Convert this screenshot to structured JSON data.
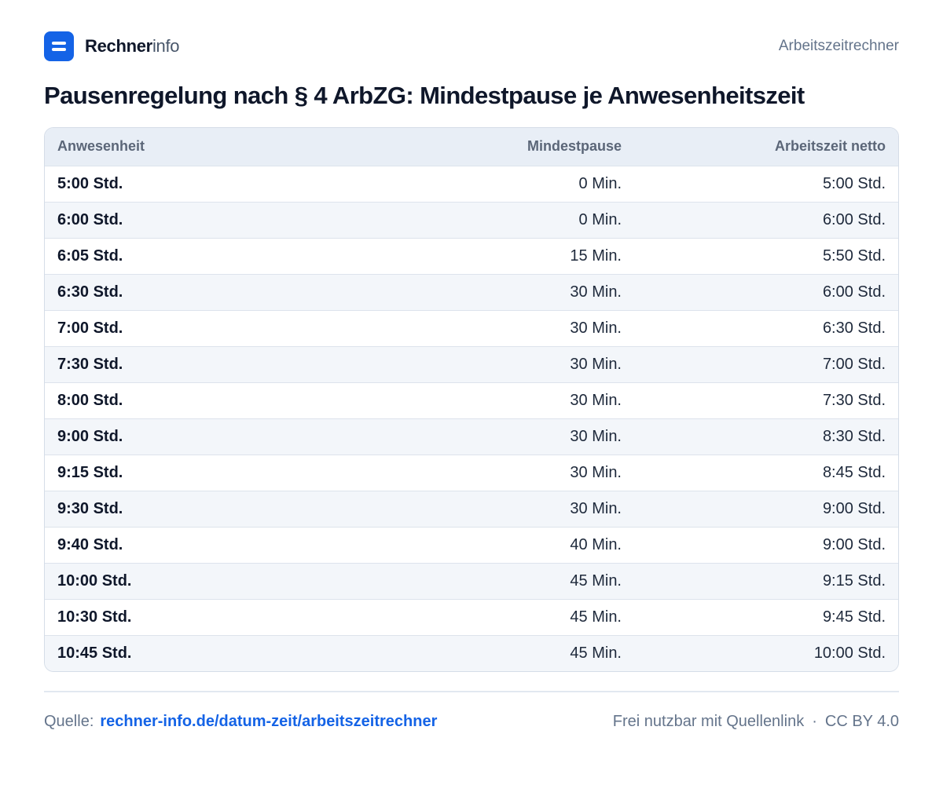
{
  "header": {
    "brand_strong": "Rechner",
    "brand_light": "info",
    "page_label": "Arbeitszeitrechner"
  },
  "title": "Pausenregelung nach § 4 ArbZG: Mindestpause je Anwesenheitszeit",
  "table": {
    "columns": [
      "Anwesenheit",
      "Mindestpause",
      "Arbeitszeit netto"
    ],
    "rows": [
      [
        "5:00 Std.",
        "0 Min.",
        "5:00 Std."
      ],
      [
        "6:00 Std.",
        "0 Min.",
        "6:00 Std."
      ],
      [
        "6:05 Std.",
        "15 Min.",
        "5:50 Std."
      ],
      [
        "6:30 Std.",
        "30 Min.",
        "6:00 Std."
      ],
      [
        "7:00 Std.",
        "30 Min.",
        "6:30 Std."
      ],
      [
        "7:30 Std.",
        "30 Min.",
        "7:00 Std."
      ],
      [
        "8:00 Std.",
        "30 Min.",
        "7:30 Std."
      ],
      [
        "9:00 Std.",
        "30 Min.",
        "8:30 Std."
      ],
      [
        "9:15 Std.",
        "30 Min.",
        "8:45 Std."
      ],
      [
        "9:30 Std.",
        "30 Min.",
        "9:00 Std."
      ],
      [
        "9:40 Std.",
        "40 Min.",
        "9:00 Std."
      ],
      [
        "10:00 Std.",
        "45 Min.",
        "9:15 Std."
      ],
      [
        "10:30 Std.",
        "45 Min.",
        "9:45 Std."
      ],
      [
        "10:45 Std.",
        "45 Min.",
        "10:00 Std."
      ]
    ]
  },
  "footer": {
    "source_label": "Quelle:",
    "source_link": "rechner-info.de/datum-zeit/arbeitszeitrechner",
    "license_note": "Frei nutzbar mit Quellenlink",
    "separator": "·",
    "license": "CC BY 4.0"
  },
  "colors": {
    "accent": "#1463e6",
    "text": "#0f172a",
    "muted": "#64748b",
    "header_bg": "#e8eef6",
    "stripe_bg": "#f3f6fa"
  },
  "icons": {
    "logo": "logo-icon"
  }
}
